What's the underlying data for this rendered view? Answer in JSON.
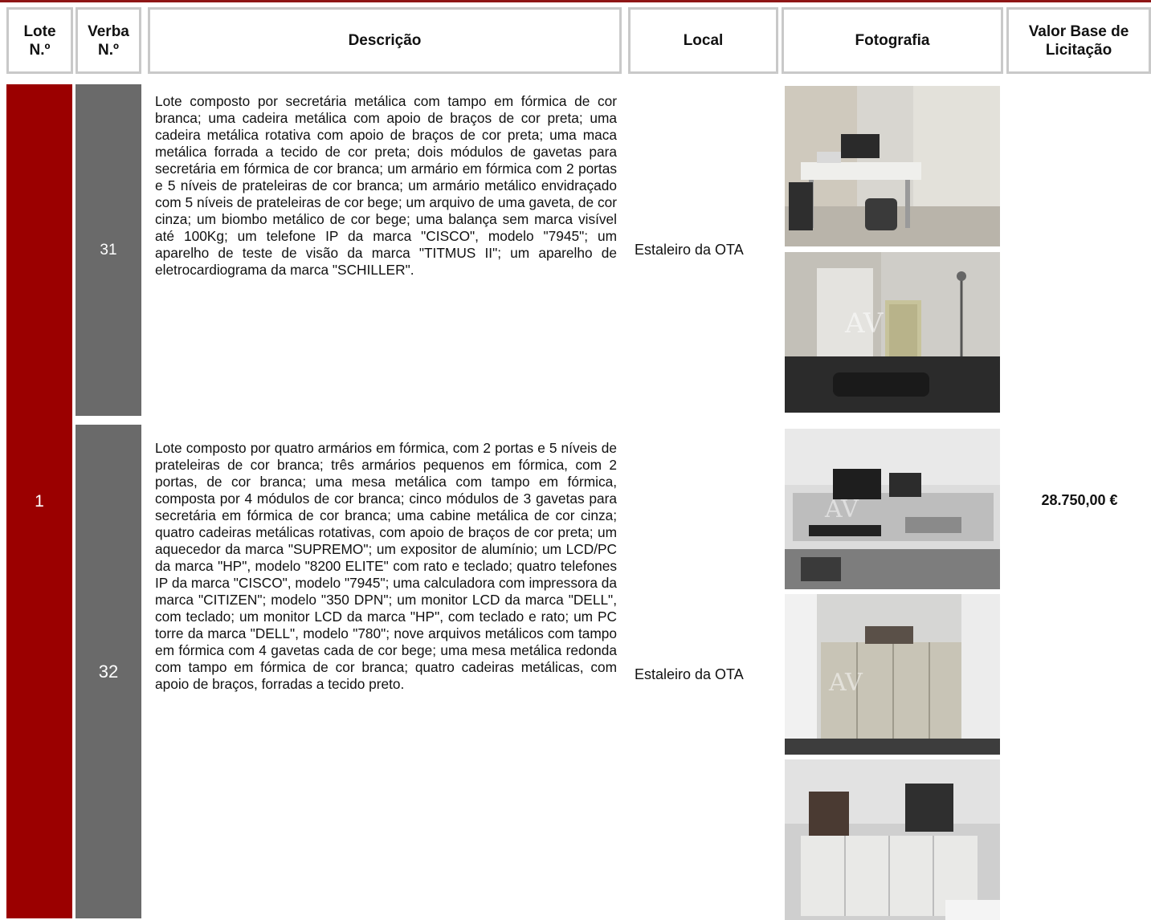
{
  "header": {
    "lote": "Lote\nN.º",
    "verba": "Verba\nN.º",
    "descricao": "Descrição",
    "local": "Local",
    "fotografia": "Fotografia",
    "valor": "Valor Base de\nLicitação"
  },
  "lote": {
    "number": "1",
    "valor_base": "28.750,00 €"
  },
  "rows": [
    {
      "verba": "31",
      "description": "Lote composto por secretária metálica com tampo em fórmica de cor branca; uma cadeira metálica com apoio de braços de cor preta; uma cadeira metálica rotativa com apoio de braços de cor preta; uma maca metálica forrada a tecido de cor preta; dois módulos de gavetas para secretária em fórmica de cor branca; um armário em fórmica com 2 portas e 5 níveis de prateleiras de cor branca; um armário metálico envidraçado com 5 níveis de prateleiras de cor bege; um arquivo de uma gaveta, de cor cinza; um biombo metálico de cor bege; uma balança sem marca visível até 100Kg; um telefone IP da marca \"CISCO\", modelo \"7945\"; um aparelho de teste de visão da marca \"TITMUS II\"; um aparelho de eletrocardiograma da marca \"SCHILLER\".",
      "local": "Estaleiro da OTA"
    },
    {
      "verba": "32",
      "description": "Lote composto por quatro armários em fórmica, com 2 portas e 5 níveis de prateleiras de cor branca; três armários pequenos em fórmica, com 2 portas, de cor branca; uma mesa metálica com tampo em fórmica, composta por 4 módulos de cor branca; cinco módulos de 3 gavetas para secretária em fórmica de cor branca; uma cabine metálica de cor cinza; quatro cadeiras metálicas rotativas, com apoio de braços de cor preta; um aquecedor da marca \"SUPREMO\"; um expositor de alumínio; um LCD/PC da marca \"HP\", modelo \"8200 ELITE\" com rato e teclado; quatro telefones IP da marca \"CISCO\", modelo \"7945\"; uma calculadora com impressora da marca \"CITIZEN\"; modelo \"350 DPN\"; um monitor LCD da marca \"DELL\", com teclado; um monitor LCD da marca \"HP\", com teclado e rato; um PC torre da marca \"DELL\", modelo \"780\"; nove arquivos metálicos com tampo em fórmica com 4 gavetas cada de cor bege; uma mesa metálica redonda com tampo em fórmica de cor branca; quatro cadeiras metálicas, com apoio de braços, forradas a tecido preto.",
      "local": "Estaleiro da OTA"
    }
  ]
}
